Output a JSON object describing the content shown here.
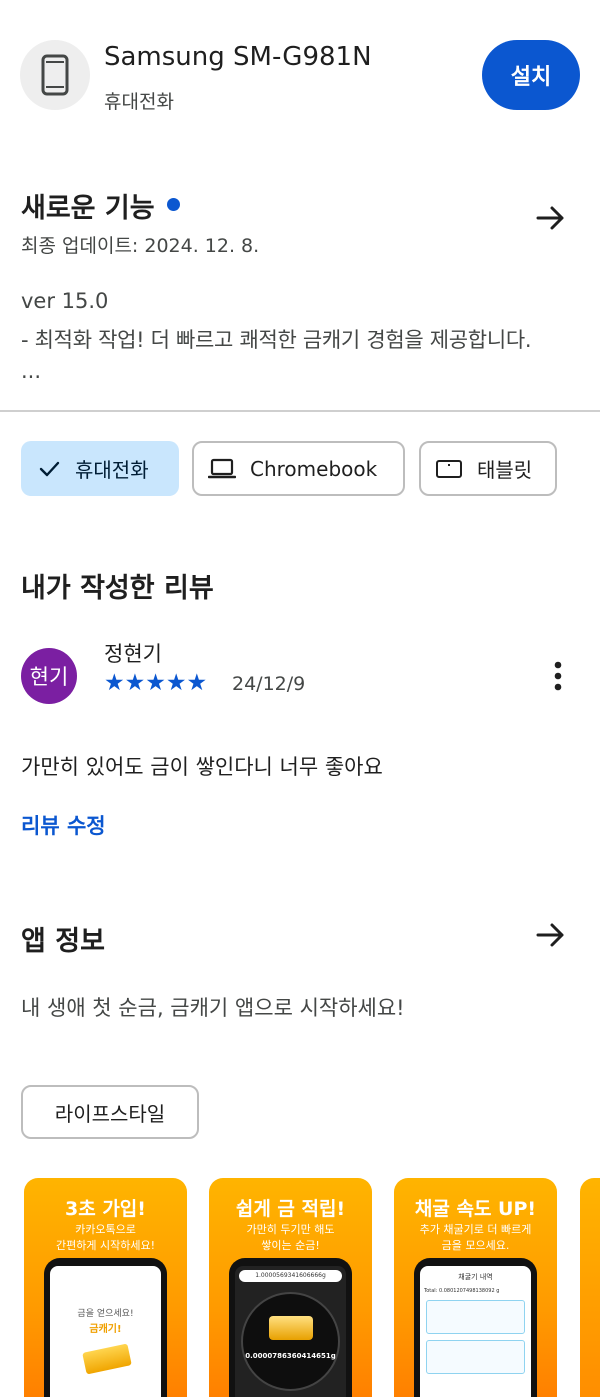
{
  "device": {
    "name": "Samsung SM-G981N",
    "type": "휴대전화",
    "install_label": "설치"
  },
  "whats_new": {
    "title": "새로운 기능",
    "updated": "최종 업데이트: 2024. 12. 8.",
    "version": "ver 15.0",
    "notes": "- 최적화 작업! 더 빠르고 쾌적한 금캐기 경험을 제공합니다.",
    "ellipsis": "..."
  },
  "device_chips": [
    {
      "label": "휴대전화",
      "icon": "check-icon",
      "selected": true
    },
    {
      "label": "Chromebook",
      "icon": "laptop-icon",
      "selected": false
    },
    {
      "label": "태블릿",
      "icon": "tablet-icon",
      "selected": false
    }
  ],
  "my_review": {
    "title": "내가 작성한 리뷰",
    "avatar_text": "현기",
    "reviewer_name": "정현기",
    "rating": 5,
    "stars": "★★★★★",
    "date": "24/12/9",
    "text": "가만히 있어도 금이 쌓인다니 너무 좋아요",
    "edit_label": "리뷰 수정"
  },
  "about": {
    "title": "앱 정보",
    "description": "내 생애 첫 순금, 금캐기 앱으로 시작하세요!",
    "category": "라이프스타일"
  },
  "screenshots": [
    {
      "title": "3초 가입!",
      "subtitle_1": "카카오톡으로",
      "subtitle_2": "간편하게 시작하세요!",
      "screen_text_1": "금을 얻으세요!",
      "screen_text_2": "금캐기!"
    },
    {
      "title": "쉽게 금 적립!",
      "subtitle_1": "가만히 두기만 해도",
      "subtitle_2": "쌓이는 순금!",
      "screen_text_1": "1.0000569341606666g",
      "screen_text_2": "0.0000786360414651g"
    },
    {
      "title": "채굴 속도 UP!",
      "subtitle_1": "추가 채굴기로 더 빠르게",
      "subtitle_2": "금을 모으세요.",
      "screen_text_1": "채굴기 내역",
      "screen_text_2": "Total: 0.0801207498138092 g"
    }
  ],
  "colors": {
    "accent": "#0b57d0",
    "selected_chip": "#c9e6fd",
    "avatar": "#7b1fa2",
    "screenshot_orange": "#ff9a00"
  }
}
